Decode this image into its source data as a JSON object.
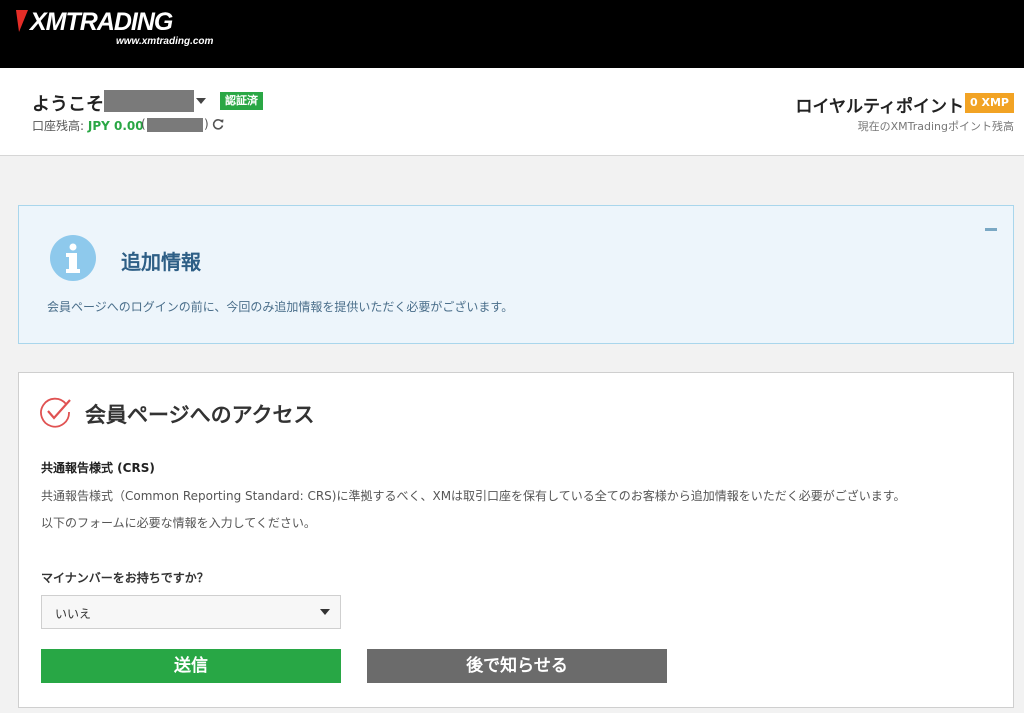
{
  "brand": {
    "logo_text": "XMTRADING",
    "logo_url": "www.xmtrading.com",
    "colors": {
      "black": "#000000",
      "green": "#28a745",
      "orange": "#f2a324",
      "info_blue": "#2e5f86"
    }
  },
  "header": {
    "welcome": "ようこそ",
    "verified_badge": "認証済",
    "balance_label": "口座残高: ",
    "balance_amount": "JPY 0.00",
    "loyalty_title": "ロイヤルティポイント",
    "loyalty_badge": "0 XMP",
    "loyalty_sub": "現在のXMTradingポイント残高",
    "icons": [
      "chevron-down-icon",
      "refresh-icon"
    ]
  },
  "info": {
    "title": "追加情報",
    "text": "会員ページへのログインの前に、今回のみ追加情報を提供いただく必要がございます。",
    "icons": [
      "info-icon",
      "collapse-icon"
    ]
  },
  "access": {
    "title": "会員ページへのアクセス",
    "crs_title": "共通報告様式 (CRS)",
    "crs_desc": "共通報告様式（Common Reporting Standard: CRS)に準拠するべく、XMは取引口座を保有している全てのお客様から追加情報をいただく必要がございます。",
    "crs_prompt": "以下のフォームに必要な情報を入力してください。",
    "question": "マイナンバーをお持ちですか？",
    "select_value": "いいえ",
    "submit_label": "送信",
    "later_label": "後で知らせる",
    "icons": [
      "check-circle-icon"
    ]
  }
}
